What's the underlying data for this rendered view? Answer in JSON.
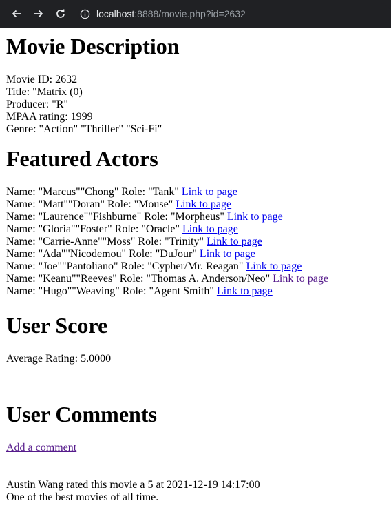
{
  "browser": {
    "url_host": "localhost",
    "url_path": ":8888/movie.php?id=2632"
  },
  "movie": {
    "heading": "Movie Description",
    "id_line": "Movie ID: 2632",
    "title_line": "Title: \"Matrix (0)",
    "producer_line": "Producer: \"R\"",
    "mpaa_line": "MPAA rating: 1999",
    "genre_line": "Genre: \"Action\" \"Thriller\" \"Sci-Fi\""
  },
  "actors": {
    "heading": "Featured Actors",
    "link_label": "Link to page",
    "items": [
      {
        "text": "Name: \"Marcus\"\"Chong\" Role: \"Tank\""
      },
      {
        "text": "Name: \"Matt\"\"Doran\" Role: \"Mouse\""
      },
      {
        "text": "Name: \"Laurence\"\"Fishburne\" Role: \"Morpheus\""
      },
      {
        "text": "Name: \"Gloria\"\"Foster\" Role: \"Oracle\""
      },
      {
        "text": "Name: \"Carrie-Anne\"\"Moss\" Role: \"Trinity\""
      },
      {
        "text": "Name: \"Ada\"\"Nicodemou\" Role: \"DuJour\""
      },
      {
        "text": "Name: \"Joe\"\"Pantoliano\" Role: \"Cypher/Mr. Reagan\""
      },
      {
        "text": "Name: \"Keanu\"\"Reeves\" Role: \"Thomas A. Anderson/Neo\""
      },
      {
        "text": "Name: \"Hugo\"\"Weaving\" Role: \"Agent Smith\""
      }
    ]
  },
  "score": {
    "heading": "User Score",
    "average": "Average Rating: 5.0000"
  },
  "comments": {
    "heading": "User Comments",
    "add_label": "Add a comment",
    "items": [
      {
        "meta": "Austin Wang rated this movie a 5 at 2021-12-19 14:17:00",
        "body": "One of the best movies of all time."
      }
    ]
  }
}
